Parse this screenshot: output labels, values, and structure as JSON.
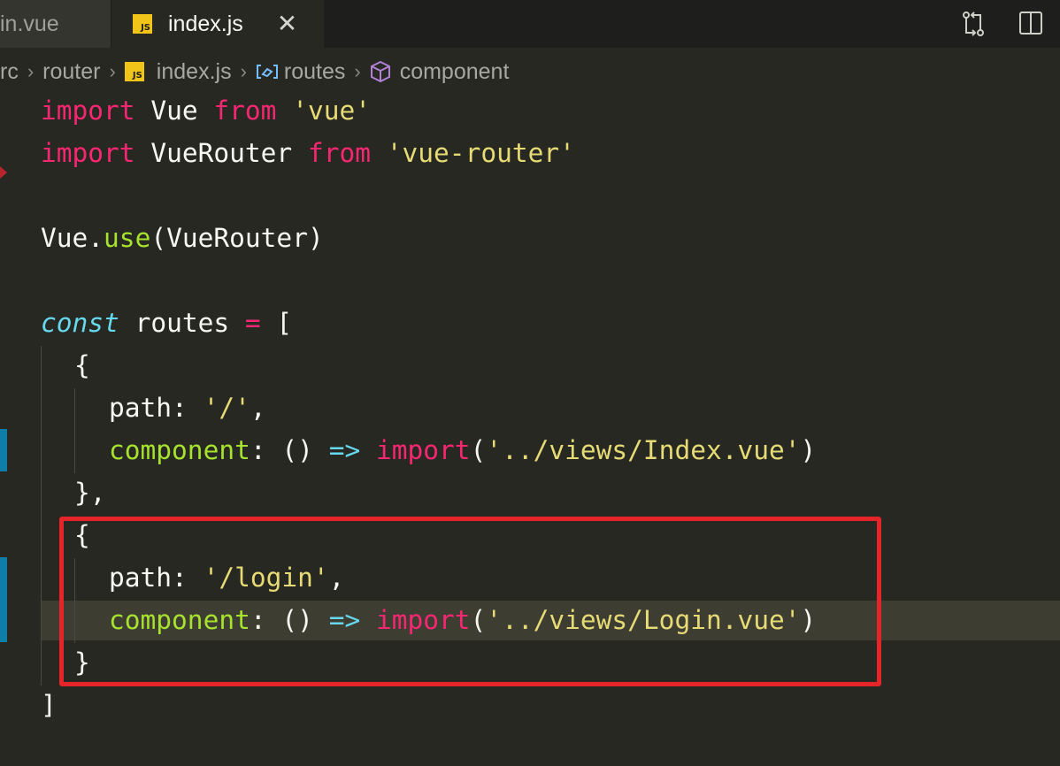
{
  "tabs": [
    {
      "label": "in.vue",
      "active": false
    },
    {
      "label": "index.js",
      "active": true,
      "badge": "JS",
      "close": "✕"
    }
  ],
  "breadcrumb": {
    "items": [
      "rc",
      "router",
      "index.js",
      "routes",
      "component"
    ],
    "separator": "›",
    "badge": "JS"
  },
  "code": {
    "line1": {
      "kw1": "import",
      "name": " Vue ",
      "kw2": "from",
      "str": " 'vue'"
    },
    "line2": {
      "kw1": "import",
      "name": " VueRouter ",
      "kw2": "from",
      "str": " 'vue-router'"
    },
    "line4": {
      "obj": "Vue.",
      "fn": "use",
      "rest": "(VueRouter)"
    },
    "line6": {
      "kw": "const",
      "name": " routes ",
      "op": "=",
      "rest": " ["
    },
    "line7": {
      "text": "{"
    },
    "line8": {
      "prop": "path",
      "colon": ": ",
      "str": "'/'",
      "rest": ","
    },
    "line9": {
      "prop": "component",
      "colon": ": ",
      "paren": "() ",
      "arrow": "=>",
      "kw": " import",
      "open": "(",
      "str": "'../views/Index.vue'",
      "close": ")"
    },
    "line10": {
      "text": "},"
    },
    "line11": {
      "text": "{"
    },
    "line12": {
      "prop": "path",
      "colon": ": ",
      "str": "'/login'",
      "rest": ","
    },
    "line13": {
      "prop": "component",
      "colon": ": ",
      "paren": "() ",
      "arrow": "=>",
      "kw": " import",
      "open": "(",
      "str": "'../views/Login.vue'",
      "close": ")"
    },
    "line14": {
      "text": "}"
    },
    "line15": {
      "text": "]"
    }
  },
  "colors": {
    "editor_bg": "#272822",
    "keyword": "#f92672",
    "string": "#e6db74",
    "function": "#a6e22e",
    "storage": "#66d9ef",
    "annotation_box": "#e5252a"
  },
  "icons": [
    "js-file-icon",
    "close-icon",
    "source-control-compare-icon",
    "split-editor-icon",
    "chevron-right-icon",
    "variable-icon",
    "property-cube-icon"
  ]
}
